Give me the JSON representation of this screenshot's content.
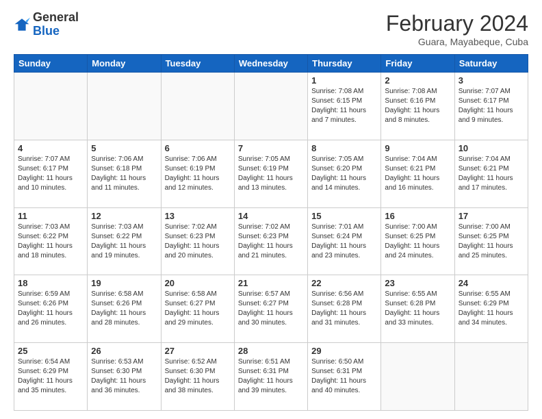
{
  "header": {
    "logo_general": "General",
    "logo_blue": "Blue",
    "month_year": "February 2024",
    "location": "Guara, Mayabeque, Cuba"
  },
  "days_of_week": [
    "Sunday",
    "Monday",
    "Tuesday",
    "Wednesday",
    "Thursday",
    "Friday",
    "Saturday"
  ],
  "weeks": [
    [
      {
        "day": "",
        "info": ""
      },
      {
        "day": "",
        "info": ""
      },
      {
        "day": "",
        "info": ""
      },
      {
        "day": "",
        "info": ""
      },
      {
        "day": "1",
        "info": "Sunrise: 7:08 AM\nSunset: 6:15 PM\nDaylight: 11 hours and 7 minutes."
      },
      {
        "day": "2",
        "info": "Sunrise: 7:08 AM\nSunset: 6:16 PM\nDaylight: 11 hours and 8 minutes."
      },
      {
        "day": "3",
        "info": "Sunrise: 7:07 AM\nSunset: 6:17 PM\nDaylight: 11 hours and 9 minutes."
      }
    ],
    [
      {
        "day": "4",
        "info": "Sunrise: 7:07 AM\nSunset: 6:17 PM\nDaylight: 11 hours and 10 minutes."
      },
      {
        "day": "5",
        "info": "Sunrise: 7:06 AM\nSunset: 6:18 PM\nDaylight: 11 hours and 11 minutes."
      },
      {
        "day": "6",
        "info": "Sunrise: 7:06 AM\nSunset: 6:19 PM\nDaylight: 11 hours and 12 minutes."
      },
      {
        "day": "7",
        "info": "Sunrise: 7:05 AM\nSunset: 6:19 PM\nDaylight: 11 hours and 13 minutes."
      },
      {
        "day": "8",
        "info": "Sunrise: 7:05 AM\nSunset: 6:20 PM\nDaylight: 11 hours and 14 minutes."
      },
      {
        "day": "9",
        "info": "Sunrise: 7:04 AM\nSunset: 6:21 PM\nDaylight: 11 hours and 16 minutes."
      },
      {
        "day": "10",
        "info": "Sunrise: 7:04 AM\nSunset: 6:21 PM\nDaylight: 11 hours and 17 minutes."
      }
    ],
    [
      {
        "day": "11",
        "info": "Sunrise: 7:03 AM\nSunset: 6:22 PM\nDaylight: 11 hours and 18 minutes."
      },
      {
        "day": "12",
        "info": "Sunrise: 7:03 AM\nSunset: 6:22 PM\nDaylight: 11 hours and 19 minutes."
      },
      {
        "day": "13",
        "info": "Sunrise: 7:02 AM\nSunset: 6:23 PM\nDaylight: 11 hours and 20 minutes."
      },
      {
        "day": "14",
        "info": "Sunrise: 7:02 AM\nSunset: 6:23 PM\nDaylight: 11 hours and 21 minutes."
      },
      {
        "day": "15",
        "info": "Sunrise: 7:01 AM\nSunset: 6:24 PM\nDaylight: 11 hours and 23 minutes."
      },
      {
        "day": "16",
        "info": "Sunrise: 7:00 AM\nSunset: 6:25 PM\nDaylight: 11 hours and 24 minutes."
      },
      {
        "day": "17",
        "info": "Sunrise: 7:00 AM\nSunset: 6:25 PM\nDaylight: 11 hours and 25 minutes."
      }
    ],
    [
      {
        "day": "18",
        "info": "Sunrise: 6:59 AM\nSunset: 6:26 PM\nDaylight: 11 hours and 26 minutes."
      },
      {
        "day": "19",
        "info": "Sunrise: 6:58 AM\nSunset: 6:26 PM\nDaylight: 11 hours and 28 minutes."
      },
      {
        "day": "20",
        "info": "Sunrise: 6:58 AM\nSunset: 6:27 PM\nDaylight: 11 hours and 29 minutes."
      },
      {
        "day": "21",
        "info": "Sunrise: 6:57 AM\nSunset: 6:27 PM\nDaylight: 11 hours and 30 minutes."
      },
      {
        "day": "22",
        "info": "Sunrise: 6:56 AM\nSunset: 6:28 PM\nDaylight: 11 hours and 31 minutes."
      },
      {
        "day": "23",
        "info": "Sunrise: 6:55 AM\nSunset: 6:28 PM\nDaylight: 11 hours and 33 minutes."
      },
      {
        "day": "24",
        "info": "Sunrise: 6:55 AM\nSunset: 6:29 PM\nDaylight: 11 hours and 34 minutes."
      }
    ],
    [
      {
        "day": "25",
        "info": "Sunrise: 6:54 AM\nSunset: 6:29 PM\nDaylight: 11 hours and 35 minutes."
      },
      {
        "day": "26",
        "info": "Sunrise: 6:53 AM\nSunset: 6:30 PM\nDaylight: 11 hours and 36 minutes."
      },
      {
        "day": "27",
        "info": "Sunrise: 6:52 AM\nSunset: 6:30 PM\nDaylight: 11 hours and 38 minutes."
      },
      {
        "day": "28",
        "info": "Sunrise: 6:51 AM\nSunset: 6:31 PM\nDaylight: 11 hours and 39 minutes."
      },
      {
        "day": "29",
        "info": "Sunrise: 6:50 AM\nSunset: 6:31 PM\nDaylight: 11 hours and 40 minutes."
      },
      {
        "day": "",
        "info": ""
      },
      {
        "day": "",
        "info": ""
      }
    ]
  ]
}
